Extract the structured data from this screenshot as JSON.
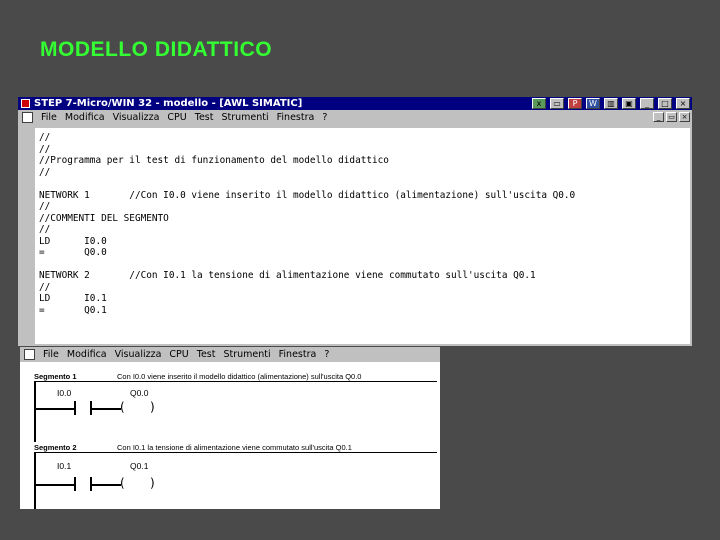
{
  "slide": {
    "title": "MODELLO DIDATTICO"
  },
  "stl_window": {
    "title": "STEP 7-Micro/WIN 32 - modello - [AWL SIMATIC]",
    "menu": [
      "File",
      "Modifica",
      "Visualizza",
      "CPU",
      "Test",
      "Strumenti",
      "Finestra",
      "?"
    ],
    "lines": [
      "//",
      "//",
      "//Programma per il test di funzionamento del modello didattico",
      "//",
      "",
      "NETWORK 1       //Con I0.0 viene inserito il modello didattico (alimentazione) sull'uscita Q0.0",
      "//",
      "//COMMENTI DEL SEGMENTO",
      "//",
      "LD      I0.0",
      "=       Q0.0",
      "",
      "NETWORK 2       //Con I0.1 la tensione di alimentazione viene commutato sull'uscita Q0.1",
      "//",
      "LD      I0.1",
      "=       Q0.1"
    ]
  },
  "ladder_window": {
    "menu": [
      "File",
      "Modifica",
      "Visualizza",
      "CPU",
      "Test",
      "Strumenti",
      "Finestra",
      "?"
    ],
    "segments": [
      {
        "name": "Segmento 1",
        "comment": "Con I0.0 viene inserito il modello didattico (alimentazione) sull'uscita Q0.0",
        "contact": "I0.0",
        "coil": "Q0.0"
      },
      {
        "name": "Segmento 2",
        "comment": "Con I0.1 la tensione di alimentazione viene commutato sull'uscita Q0.1",
        "contact": "I0.1",
        "coil": "Q0.1"
      }
    ]
  },
  "coil_symbol": {
    "open": "(",
    "close": ")"
  }
}
